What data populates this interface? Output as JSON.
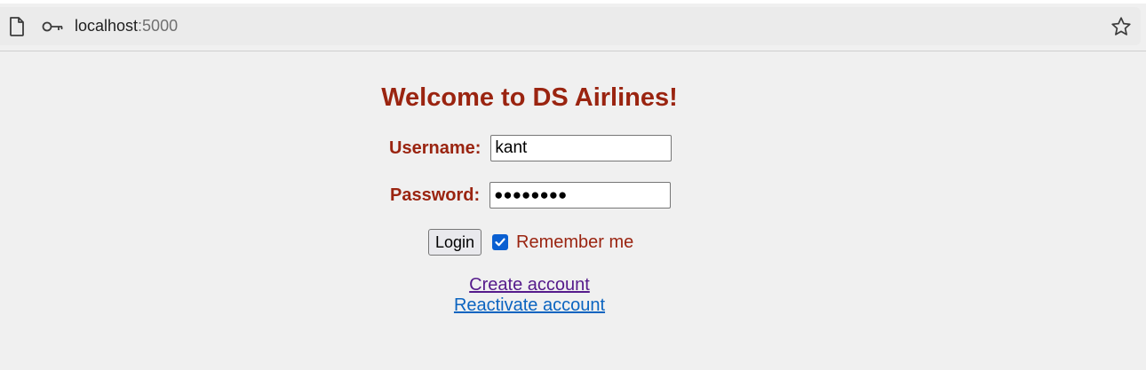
{
  "browser": {
    "url_host": "localhost",
    "url_port": ":5000",
    "icons": [
      "page-icon",
      "key-icon",
      "star-icon"
    ]
  },
  "page": {
    "title": "Welcome to DS Airlines!",
    "username_label": "Username:",
    "username_value": "kant",
    "password_label": "Password:",
    "password_masked": "●●●●●●●●",
    "login_label": "Login",
    "remember_checked": true,
    "remember_label": "Remember me",
    "create_account_label": "Create account",
    "reactivate_account_label": "Reactivate account"
  },
  "colors": {
    "heading": "#9a2410",
    "checkbox": "#0a5fd1",
    "visited_link": "#551a8b",
    "link": "#0b64c0",
    "background": "#f0f0f0"
  }
}
